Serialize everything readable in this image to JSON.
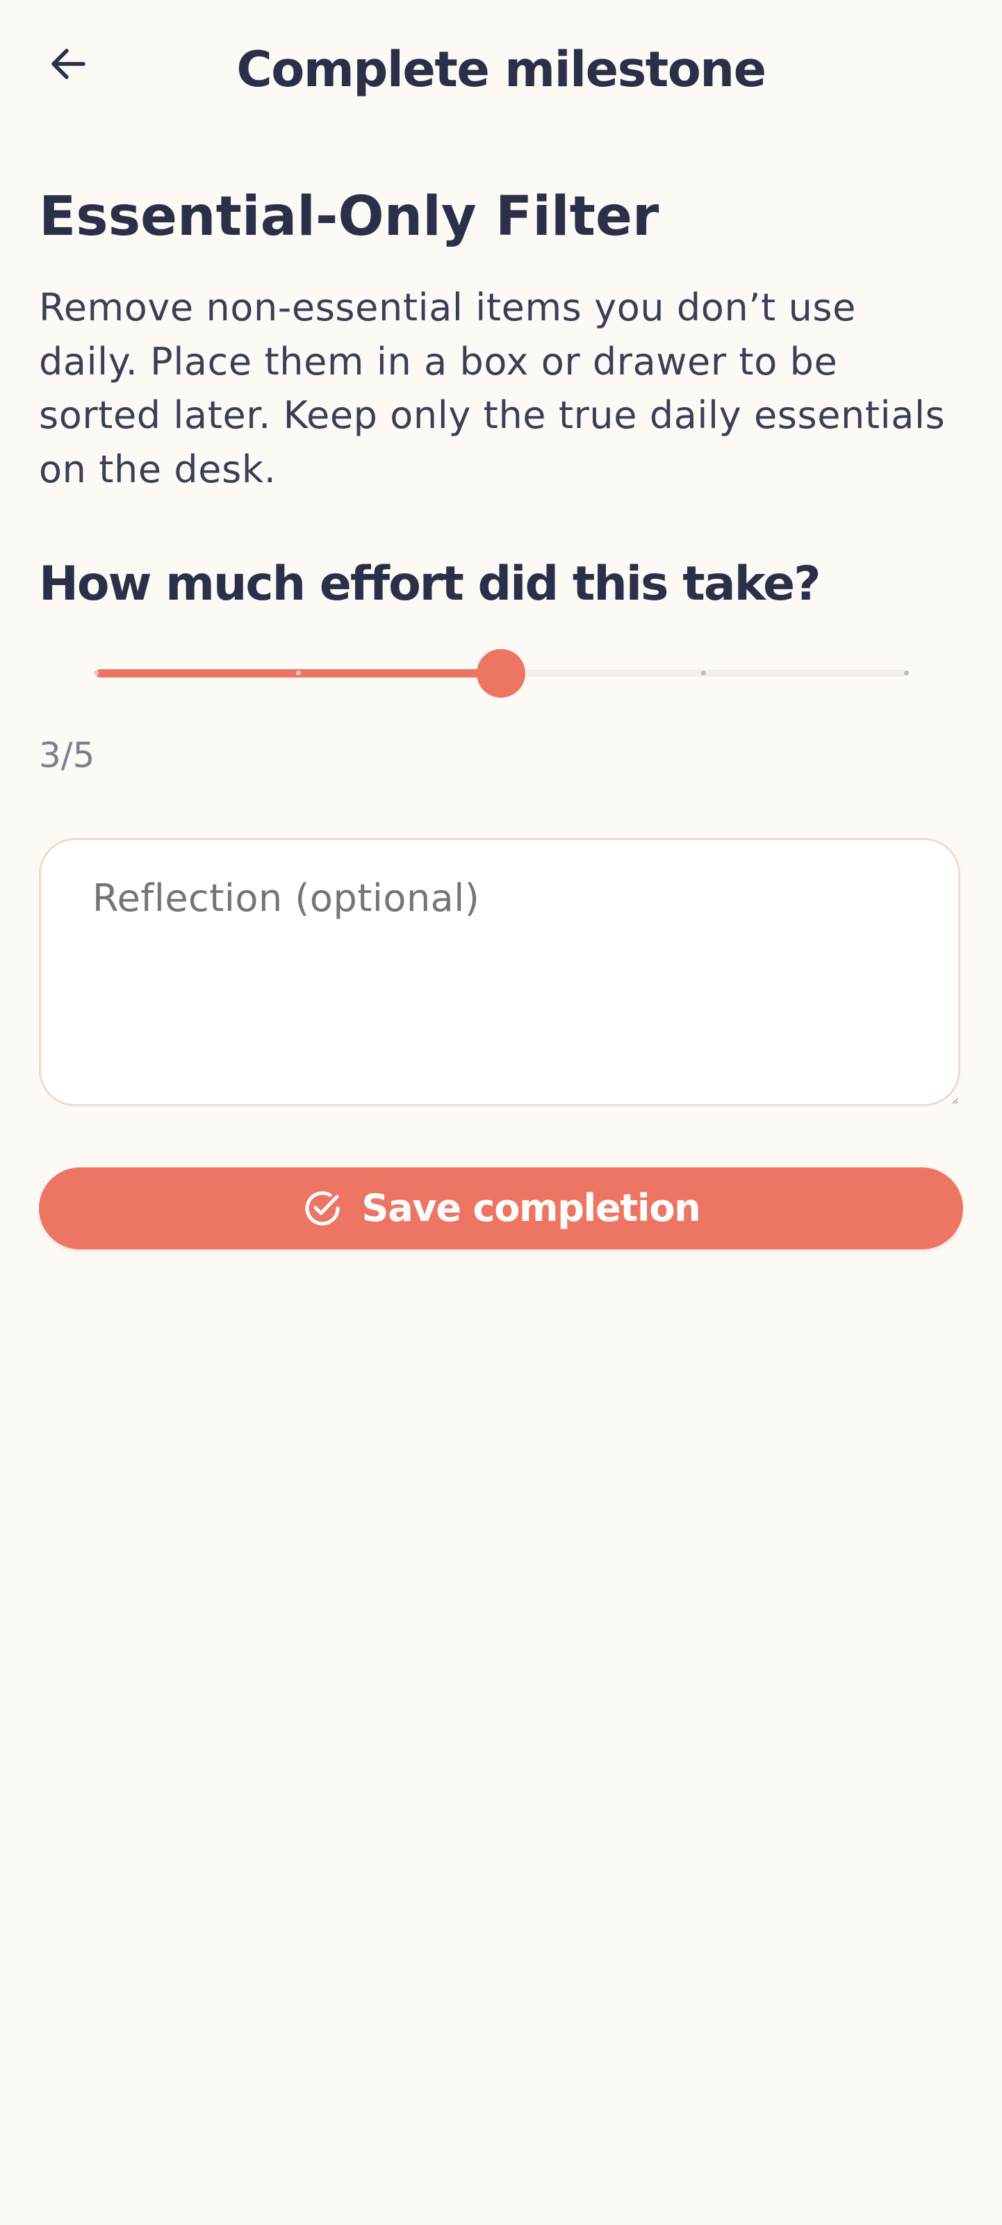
{
  "app_bar": {
    "back_icon": "arrow-left-icon",
    "title": "Complete milestone"
  },
  "milestone": {
    "title": "Essential-Only Filter",
    "description": "Remove non-essential items you don’t use daily. Place them in a box or drawer to be sorted later. Keep only the true daily essentials on the desk."
  },
  "effort": {
    "question": "How much effort did this take?",
    "value": 3,
    "min": 1,
    "max": 5,
    "value_label": "3/5"
  },
  "reflection": {
    "placeholder": "Reflection (optional)",
    "value": ""
  },
  "save": {
    "icon": "check-circle-icon",
    "label": "Save completion"
  },
  "colors": {
    "background": "#FDFAF6",
    "accent": "#EC7663",
    "text_primary": "#2B3049",
    "text_muted": "#7D7F8C",
    "field_border": "#EEDCCC"
  }
}
